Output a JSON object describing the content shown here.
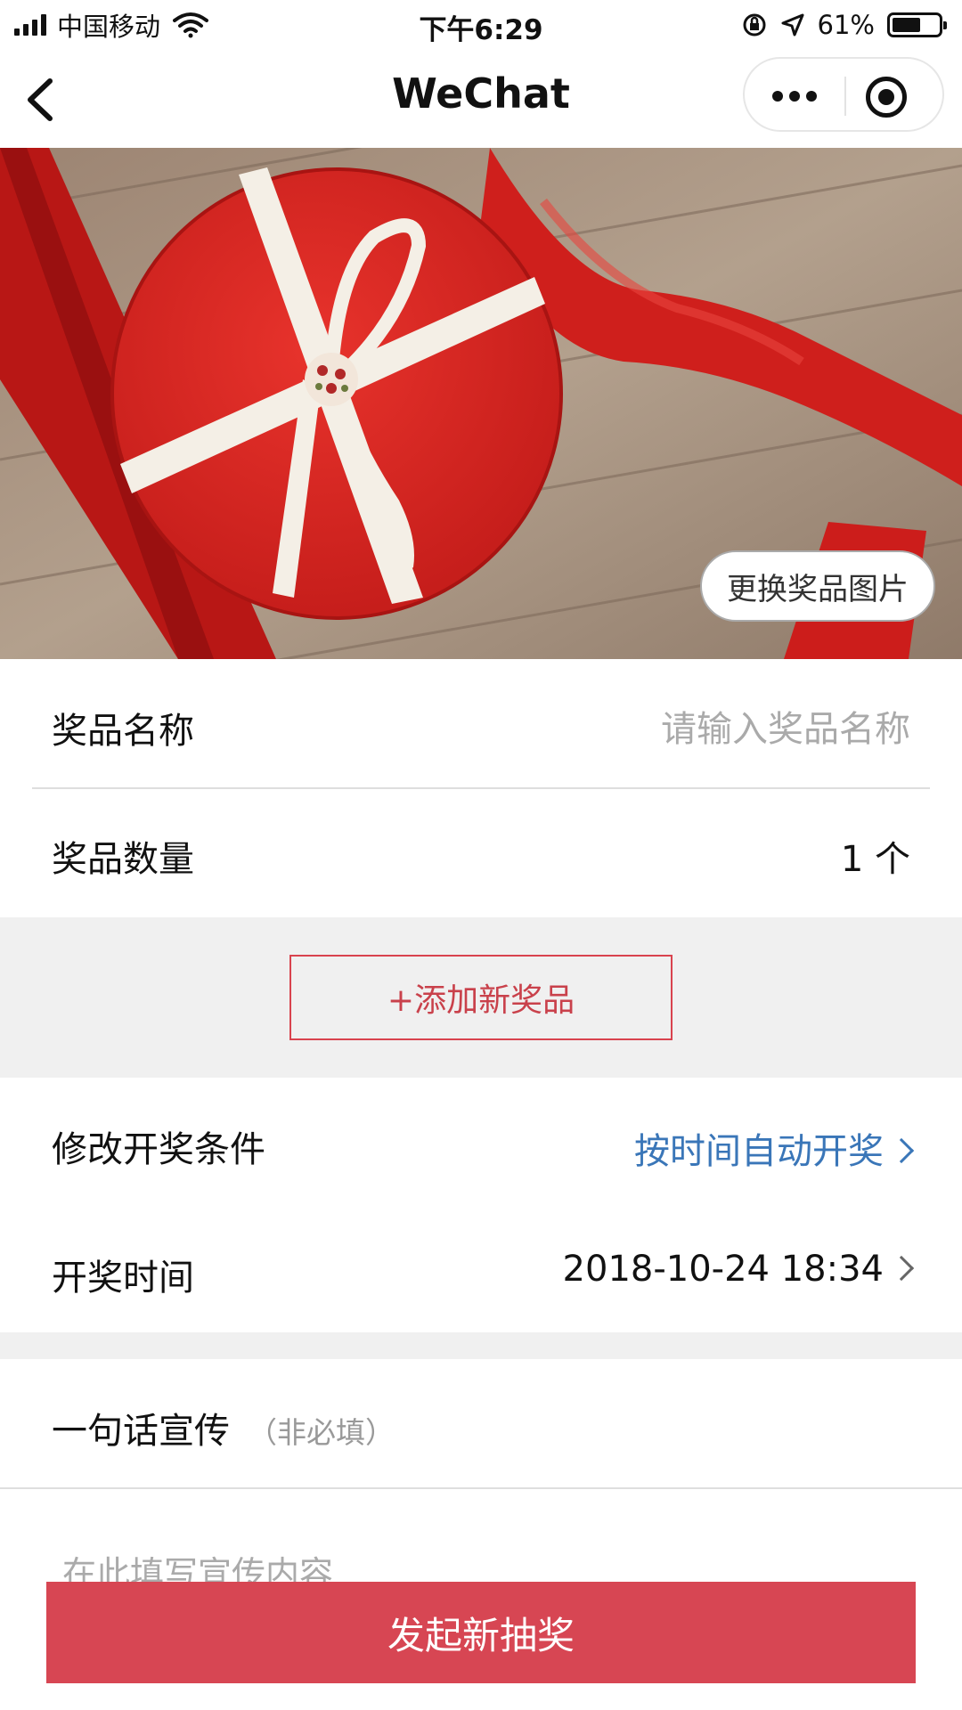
{
  "status_bar": {
    "carrier": "中国移动",
    "time": "下午6:29",
    "battery_percent": "61%",
    "battery_level": 0.61,
    "icons": [
      "signal-icon",
      "wifi-icon",
      "orientation-lock-icon",
      "location-icon",
      "battery-icon"
    ]
  },
  "nav": {
    "title": "WeChat",
    "icons": [
      "back-icon",
      "more-icon",
      "close-miniprogram-icon"
    ]
  },
  "hero": {
    "change_image_label": "更换奖品图片",
    "colors": {
      "gift_red": "#d8231f",
      "ribbon_white": "#f4efe6",
      "wood": "#a89583"
    }
  },
  "form": {
    "prize_name": {
      "label": "奖品名称",
      "placeholder": "请输入奖品名称"
    },
    "prize_quantity": {
      "label": "奖品数量",
      "value": "1 个"
    },
    "add_prize_label": "+添加新奖品",
    "draw_condition": {
      "label": "修改开奖条件",
      "value": "按时间自动开奖"
    },
    "draw_time": {
      "label": "开奖时间",
      "value": "2018-10-24 18:34"
    },
    "slogan": {
      "label": "一句话宣传",
      "note": "（非必填）",
      "placeholder": "在此填写宣传内容"
    }
  },
  "submit_label": "发起新抽奖",
  "colors": {
    "accent_red": "#d74653",
    "link_blue": "#3a76b8",
    "band_gray": "#f0f0f0"
  }
}
